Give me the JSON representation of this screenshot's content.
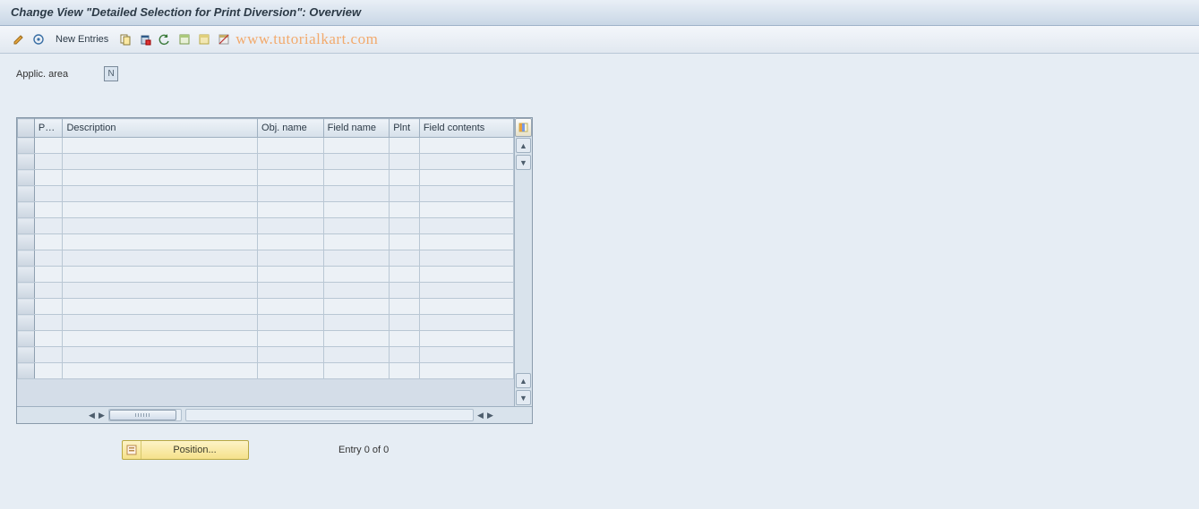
{
  "title": "Change View \"Detailed Selection for Print Diversion\": Overview",
  "toolbar": {
    "new_entries": "New Entries"
  },
  "watermark": "www.tutorialkart.com",
  "form": {
    "applic_area_label": "Applic. area",
    "applic_area_value": "N"
  },
  "table": {
    "headers": {
      "pap": "Pap.",
      "description": "Description",
      "obj_name": "Obj. name",
      "field_name": "Field name",
      "plnt": "Plnt",
      "field_contents": "Field contents"
    }
  },
  "footer": {
    "position_label": "Position...",
    "entry_info": "Entry 0 of 0"
  }
}
